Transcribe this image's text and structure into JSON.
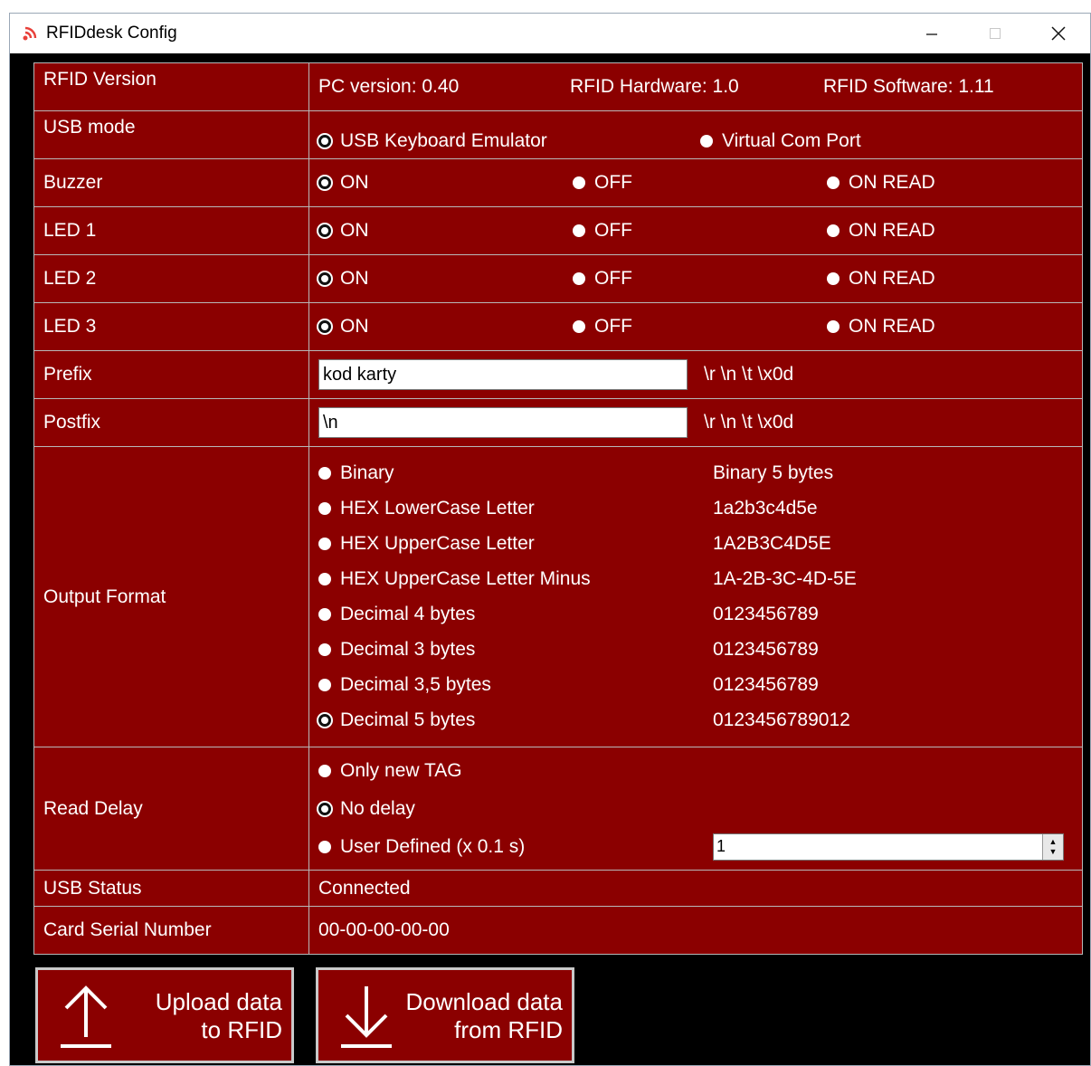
{
  "window": {
    "title": "RFIDdesk Config"
  },
  "rows": {
    "version": {
      "label": "RFID Version",
      "pc": "PC version: 0.40",
      "hw": "RFID Hardware: 1.0",
      "sw": "RFID Software: 1.11"
    },
    "usb_mode": {
      "label": "USB mode",
      "options": [
        "USB Keyboard Emulator",
        "Virtual Com Port"
      ],
      "selected": 0
    },
    "buzzer": {
      "label": "Buzzer",
      "options": [
        "ON",
        "OFF",
        "ON READ"
      ],
      "selected": 0
    },
    "led1": {
      "label": "LED 1",
      "options": [
        "ON",
        "OFF",
        "ON READ"
      ],
      "selected": 0
    },
    "led2": {
      "label": "LED 2",
      "options": [
        "ON",
        "OFF",
        "ON READ"
      ],
      "selected": 0
    },
    "led3": {
      "label": "LED 3",
      "options": [
        "ON",
        "OFF",
        "ON READ"
      ],
      "selected": 0
    },
    "prefix": {
      "label": "Prefix",
      "value": "kod karty",
      "hint": "\\r \\n \\t \\x0d"
    },
    "postfix": {
      "label": "Postfix",
      "value": "\\n",
      "hint": "\\r \\n \\t \\x0d"
    },
    "output_format": {
      "label": "Output Format",
      "selected": 7,
      "options": [
        {
          "label": "Binary",
          "example": "Binary 5 bytes"
        },
        {
          "label": "HEX LowerCase Letter",
          "example": "1a2b3c4d5e"
        },
        {
          "label": "HEX UpperCase Letter",
          "example": "1A2B3C4D5E"
        },
        {
          "label": "HEX UpperCase Letter Minus",
          "example": "1A-2B-3C-4D-5E"
        },
        {
          "label": "Decimal 4 bytes",
          "example": "0123456789"
        },
        {
          "label": "Decimal 3 bytes",
          "example": "0123456789"
        },
        {
          "label": "Decimal 3,5 bytes",
          "example": "0123456789"
        },
        {
          "label": "Decimal 5 bytes",
          "example": "0123456789012"
        }
      ]
    },
    "read_delay": {
      "label": "Read Delay",
      "options": [
        "Only new TAG",
        "No delay",
        "User Defined (x 0.1 s)"
      ],
      "selected": 1,
      "user_value": "1"
    },
    "usb_status": {
      "label": "USB Status",
      "value": "Connected"
    },
    "card_serial": {
      "label": "Card Serial Number",
      "value": "00-00-00-00-00"
    }
  },
  "buttons": {
    "upload": {
      "line1": "Upload data",
      "line2": "to RFID",
      "icon": "arrow-up-icon"
    },
    "download": {
      "line1": "Download data",
      "line2": "from RFID",
      "icon": "arrow-down-icon"
    }
  },
  "colors": {
    "panel": "#8b0000",
    "background": "#000000",
    "grid": "#b8b8b8"
  }
}
